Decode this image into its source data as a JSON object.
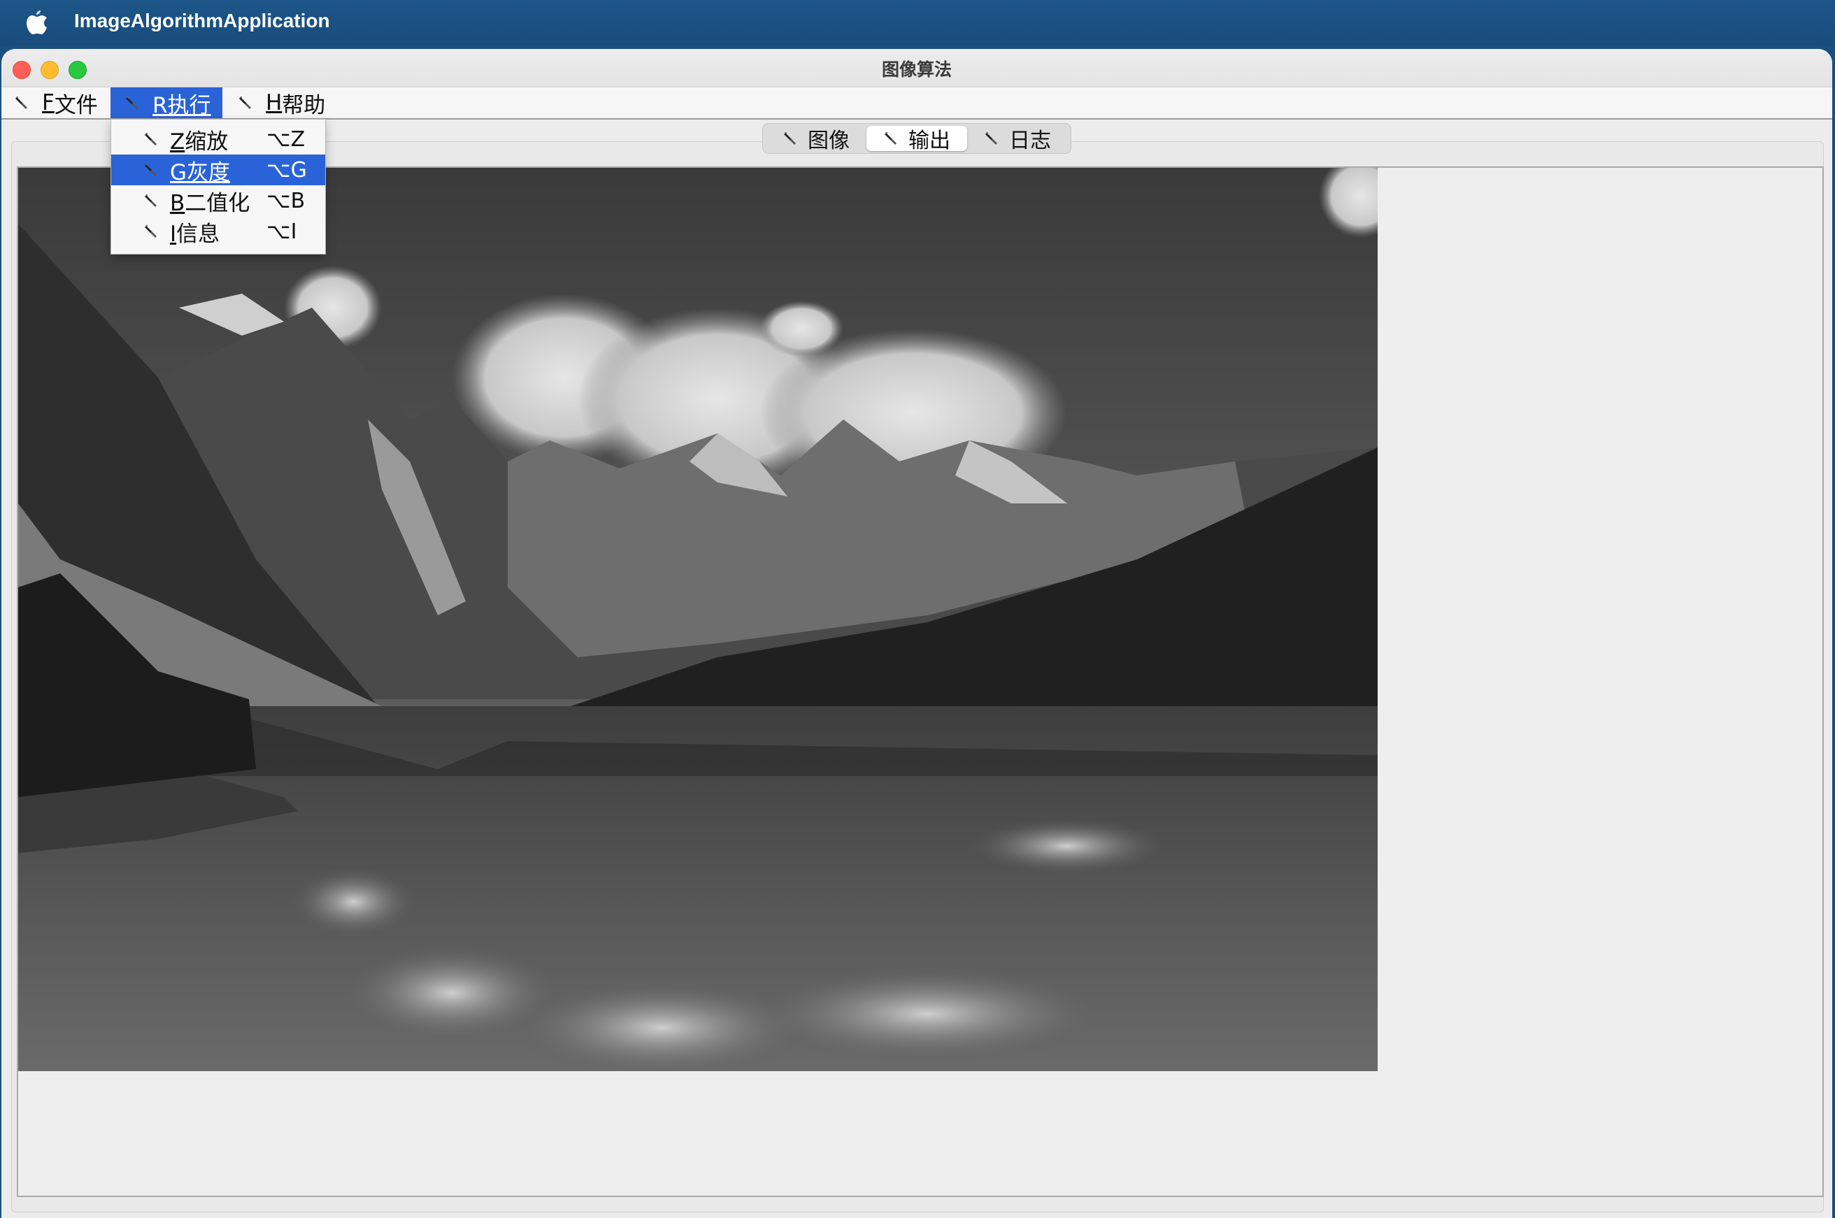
{
  "system_menubar": {
    "app_name": "ImageAlgorithmApplication",
    "apple_icon": "apple-icon"
  },
  "window": {
    "title": "图像算法"
  },
  "menubar": {
    "file": {
      "mnemonic": "F",
      "label": "文件"
    },
    "run": {
      "mnemonic": "R",
      "label": "执行"
    },
    "help": {
      "mnemonic": "H",
      "label": "帮助"
    }
  },
  "run_menu": {
    "items": [
      {
        "mnemonic": "Z",
        "label": "缩放",
        "shortcut": "⌥Z"
      },
      {
        "mnemonic": "G",
        "label": "灰度",
        "shortcut": "⌥G",
        "selected": true
      },
      {
        "mnemonic": "B",
        "label": "二值化",
        "shortcut": "⌥B"
      },
      {
        "mnemonic": "I",
        "label": "信息",
        "shortcut": "⌥I"
      }
    ]
  },
  "tabs": [
    {
      "label": "图像"
    },
    {
      "label": "输出",
      "active": true
    },
    {
      "label": "日志"
    }
  ],
  "colors": {
    "accent": "#2a63d8",
    "system_bar": "#1b4f7e",
    "window_bg": "#ececec"
  }
}
